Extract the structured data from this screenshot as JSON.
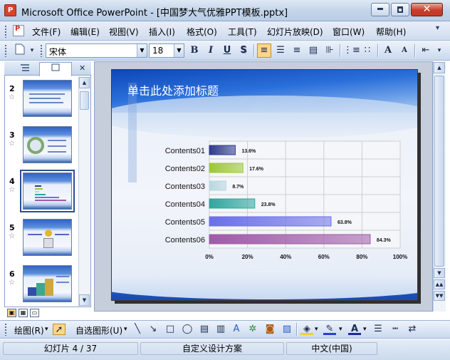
{
  "window": {
    "title": "Microsoft Office PowerPoint - [中国梦大气优雅PPT模板.pptx]",
    "icon_label": "P",
    "controls": [
      "minimize-icon",
      "maximize-icon",
      "close-icon"
    ],
    "close_glyph": "✕"
  },
  "menu": {
    "items": [
      "文件(F)",
      "编辑(E)",
      "视图(V)",
      "插入(I)",
      "格式(O)",
      "工具(T)",
      "幻灯片放映(D)",
      "窗口(W)",
      "帮助(H)"
    ],
    "expand_glyph": "▾"
  },
  "toolbar": {
    "font_name": "宋体",
    "font_size": "18",
    "bold": "B",
    "italic": "I",
    "underline": "U",
    "shadow": "S",
    "grow": "A",
    "shrink": "A",
    "icons": [
      "new-document-icon",
      "align-left-icon",
      "center-icon",
      "align-right-icon",
      "distribute-icon",
      "numbering-icon",
      "bullets-icon",
      "increase-font-icon",
      "decrease-font-icon",
      "indent-icon"
    ]
  },
  "slides_pane": {
    "tabs": [
      "outline-tab",
      "slides-tab"
    ],
    "close_glyph": "✕",
    "slides": [
      {
        "number": "2",
        "star": "☆"
      },
      {
        "number": "3",
        "star": "☆"
      },
      {
        "number": "4",
        "star": "☆",
        "selected": true
      },
      {
        "number": "5",
        "star": "☆"
      },
      {
        "number": "6",
        "star": "☆"
      }
    ]
  },
  "slide": {
    "title_placeholder": "单击此处添加标题"
  },
  "chart_data": {
    "type": "bar",
    "orientation": "horizontal",
    "categories": [
      "Contents01",
      "Contents02",
      "Contents03",
      "Contents04",
      "Contents05",
      "Contents06"
    ],
    "values": [
      13.6,
      17.6,
      8.7,
      23.8,
      63.8,
      84.3
    ],
    "value_labels": [
      "13.6%",
      "17.6%",
      "8.7%",
      "23.8%",
      "63.8%",
      "84.3%"
    ],
    "colors": [
      "#2f3a8c",
      "#9cc832",
      "#b8d6e0",
      "#2ea69e",
      "#6b6fe8",
      "#a05aa8"
    ],
    "xlim": [
      0,
      100
    ],
    "xticks": [
      "0%",
      "20%",
      "40%",
      "60%",
      "80%",
      "100%"
    ],
    "grid": true
  },
  "draw_toolbar": {
    "draw_label": "绘图(R)",
    "autoshape_label": "自选图形(U)",
    "dropdown_glyph": "▾",
    "icons": [
      "pointer-icon",
      "line-icon",
      "arrow-icon",
      "rectangle-icon",
      "oval-icon",
      "textbox-icon",
      "vertical-textbox-icon",
      "wordart-icon",
      "diagram-icon",
      "clipart-icon",
      "picture-icon",
      "fill-color-icon",
      "line-color-icon",
      "font-color-icon",
      "line-style-icon",
      "dash-style-icon",
      "arrow-style-icon"
    ]
  },
  "status": {
    "slide_position": "幻灯片 4 / 37",
    "design": "自定义设计方案",
    "language": "中文(中国)"
  }
}
